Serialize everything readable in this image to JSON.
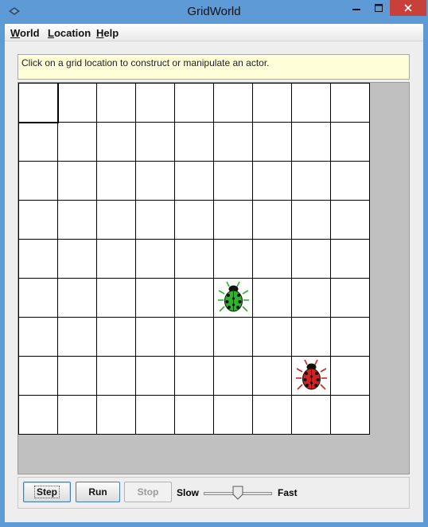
{
  "window": {
    "title": "GridWorld",
    "icons": {
      "app": "gridworld-icon",
      "minimize": "minimize-icon",
      "maximize": "maximize-icon",
      "close": "close-icon"
    }
  },
  "menu": [
    {
      "accel": "W",
      "rest": "orld"
    },
    {
      "accel": "L",
      "rest": "ocation"
    },
    {
      "accel": "H",
      "rest": "elp"
    }
  ],
  "message": "Click on a grid location to construct or manipulate an actor.",
  "grid": {
    "rows": 9,
    "cols": 9,
    "selected": [
      0,
      0
    ],
    "actors": [
      {
        "type": "bug",
        "row": 5,
        "col": 5,
        "color": "#2bb52b",
        "icon": "bug-icon"
      },
      {
        "type": "bug",
        "row": 7,
        "col": 7,
        "color": "#d61f1f",
        "icon": "bug-icon"
      }
    ]
  },
  "controls": {
    "step_label": "Step",
    "run_label": "Run",
    "stop_label": "Stop",
    "stop_enabled": false,
    "slow_label": "Slow",
    "fast_label": "Fast",
    "speed": 0.5
  }
}
